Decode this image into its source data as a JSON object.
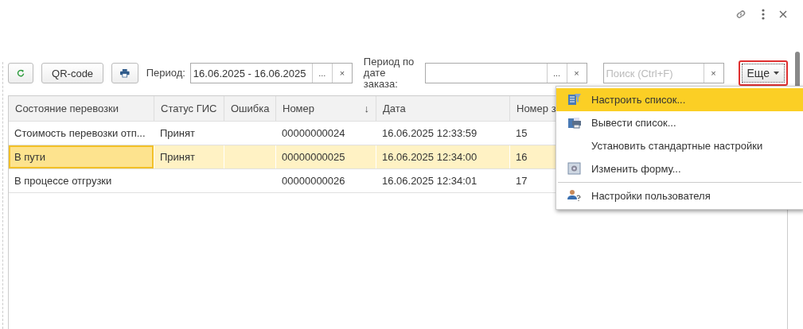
{
  "toolbar": {
    "qr_button": "QR-code",
    "period_label": "Период:",
    "period_value": "16.06.2025 - 16.06.2025",
    "period_select": "...",
    "period_clear": "×",
    "order_period_label": "Период по дате заказа:",
    "order_period_select": "...",
    "order_period_clear": "×",
    "search_placeholder": "Поиск (Ctrl+F)",
    "search_clear": "×",
    "more_button": {
      "label": "Еще",
      "highlighted": true
    }
  },
  "table": {
    "columns": [
      {
        "label": "Состояние перевозки"
      },
      {
        "label": "Статус ГИС"
      },
      {
        "label": "Ошибка"
      },
      {
        "label": "Номер",
        "sort": "↓"
      },
      {
        "label": "Дата"
      },
      {
        "label": "Номер з"
      }
    ],
    "rows": [
      {
        "cells": [
          "Стоимость перевозки отп...",
          "Принят",
          "",
          "00000000024",
          "16.06.2025 12:33:59",
          "15"
        ],
        "selected": false
      },
      {
        "cells": [
          "В пути",
          "Принят",
          "",
          "00000000025",
          "16.06.2025 12:34:00",
          "16"
        ],
        "selected": true
      },
      {
        "cells": [
          "В процессе отгрузки",
          "",
          "",
          "00000000026",
          "16.06.2025 12:34:01",
          "17"
        ],
        "selected": false
      }
    ]
  },
  "menu": {
    "items": [
      {
        "label": "Настроить список...",
        "kind": "customize",
        "selected": true,
        "divider_before": false
      },
      {
        "label": "Вывести список...",
        "kind": "print",
        "selected": false,
        "divider_before": false
      },
      {
        "label": "Установить стандартные настройки",
        "kind": "plain",
        "selected": false,
        "divider_before": false
      },
      {
        "label": "Изменить форму...",
        "kind": "form",
        "selected": false,
        "divider_before": false
      },
      {
        "label": "Настройки пользователя",
        "kind": "user",
        "selected": false,
        "divider_before": true
      }
    ]
  }
}
